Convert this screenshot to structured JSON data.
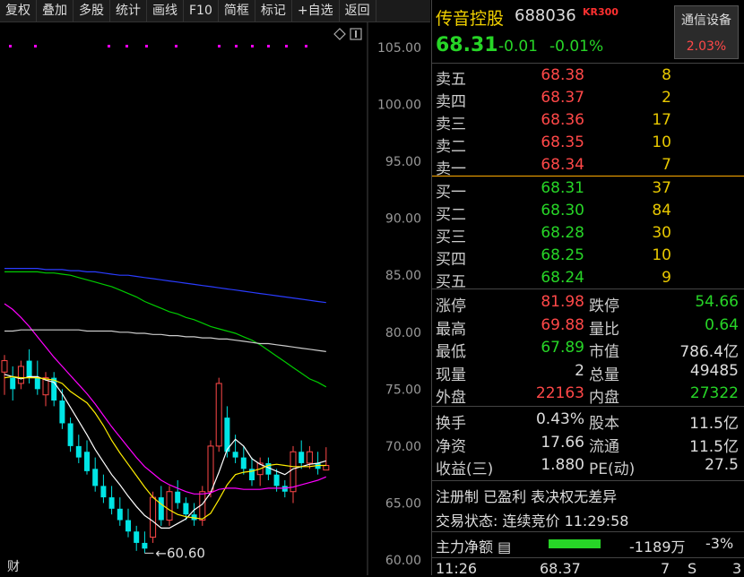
{
  "toolbar": {
    "items": [
      "复权",
      "叠加",
      "多股",
      "统计",
      "画线",
      "F10",
      "简框",
      "标记",
      "+自选",
      "返回"
    ]
  },
  "chart": {
    "y_axis_labels": [
      "105.00",
      "100.00",
      "95.00",
      "90.00",
      "85.00",
      "80.00",
      "75.00",
      "70.00",
      "65.00",
      "60.00"
    ],
    "low_marker": "60.60",
    "bottom_tab": "财",
    "colors": {
      "up": "#ff4848",
      "down": "#00e5e5",
      "ma5": "#ffffff",
      "ma10": "#ffee00",
      "ma20": "#ff00ff",
      "ma60": "#00cc00",
      "ma120": "#cccccc",
      "ma250": "#2a3cff"
    }
  },
  "chart_data": {
    "type": "candlestick",
    "ylim": [
      60,
      107
    ],
    "y_ticks": [
      60,
      65,
      70,
      75,
      80,
      85,
      90,
      95,
      100,
      105
    ],
    "candles": [
      {
        "o": 76.5,
        "h": 78.0,
        "l": 74.5,
        "c": 77.5
      },
      {
        "o": 76.0,
        "h": 77.0,
        "l": 74.0,
        "c": 75.0
      },
      {
        "o": 75.5,
        "h": 77.5,
        "l": 75.0,
        "c": 77.0
      },
      {
        "o": 77.5,
        "h": 78.5,
        "l": 75.5,
        "c": 76.0
      },
      {
        "o": 76.0,
        "h": 77.5,
        "l": 74.5,
        "c": 75.0
      },
      {
        "o": 74.5,
        "h": 76.5,
        "l": 73.5,
        "c": 76.0
      },
      {
        "o": 76.0,
        "h": 76.5,
        "l": 73.5,
        "c": 74.0
      },
      {
        "o": 74.0,
        "h": 75.0,
        "l": 71.5,
        "c": 72.0
      },
      {
        "o": 72.0,
        "h": 72.5,
        "l": 69.5,
        "c": 70.0
      },
      {
        "o": 70.0,
        "h": 71.0,
        "l": 68.5,
        "c": 69.0
      },
      {
        "o": 69.5,
        "h": 70.5,
        "l": 67.5,
        "c": 67.8
      },
      {
        "o": 68.0,
        "h": 69.0,
        "l": 66.0,
        "c": 66.5
      },
      {
        "o": 66.5,
        "h": 67.5,
        "l": 65.0,
        "c": 65.5
      },
      {
        "o": 65.5,
        "h": 66.5,
        "l": 64.0,
        "c": 64.5
      },
      {
        "o": 64.5,
        "h": 65.5,
        "l": 63.0,
        "c": 63.5
      },
      {
        "o": 63.5,
        "h": 64.5,
        "l": 62.0,
        "c": 62.5
      },
      {
        "o": 62.5,
        "h": 63.0,
        "l": 60.8,
        "c": 61.5
      },
      {
        "o": 61.5,
        "h": 62.5,
        "l": 60.6,
        "c": 61.0
      },
      {
        "o": 62.0,
        "h": 66.0,
        "l": 61.5,
        "c": 65.5
      },
      {
        "o": 65.5,
        "h": 66.5,
        "l": 63.0,
        "c": 63.5
      },
      {
        "o": 63.5,
        "h": 66.5,
        "l": 63.0,
        "c": 66.0
      },
      {
        "o": 66.0,
        "h": 67.0,
        "l": 64.5,
        "c": 65.0
      },
      {
        "o": 65.0,
        "h": 65.5,
        "l": 63.5,
        "c": 64.0
      },
      {
        "o": 64.0,
        "h": 65.0,
        "l": 63.0,
        "c": 63.5
      },
      {
        "o": 63.5,
        "h": 66.5,
        "l": 63.0,
        "c": 66.0
      },
      {
        "o": 66.0,
        "h": 70.5,
        "l": 65.5,
        "c": 70.0
      },
      {
        "o": 70.0,
        "h": 76.0,
        "l": 69.5,
        "c": 75.5
      },
      {
        "o": 72.5,
        "h": 73.5,
        "l": 69.0,
        "c": 69.5
      },
      {
        "o": 69.5,
        "h": 71.0,
        "l": 68.5,
        "c": 69.0
      },
      {
        "o": 69.0,
        "h": 70.0,
        "l": 67.5,
        "c": 68.0
      },
      {
        "o": 68.0,
        "h": 69.0,
        "l": 66.5,
        "c": 67.0
      },
      {
        "o": 67.5,
        "h": 69.0,
        "l": 66.5,
        "c": 68.5
      },
      {
        "o": 68.5,
        "h": 69.0,
        "l": 67.0,
        "c": 67.5
      },
      {
        "o": 67.5,
        "h": 68.0,
        "l": 66.0,
        "c": 66.5
      },
      {
        "o": 66.5,
        "h": 67.0,
        "l": 65.5,
        "c": 66.0
      },
      {
        "o": 66.0,
        "h": 70.0,
        "l": 65.0,
        "c": 69.5
      },
      {
        "o": 69.5,
        "h": 70.5,
        "l": 68.0,
        "c": 68.5
      },
      {
        "o": 68.5,
        "h": 70.0,
        "l": 68.0,
        "c": 69.5
      },
      {
        "o": 68.5,
        "h": 69.5,
        "l": 67.5,
        "c": 68.0
      },
      {
        "o": 67.9,
        "h": 69.9,
        "l": 67.9,
        "c": 68.3
      }
    ],
    "ma_lines": [
      {
        "name": "MA5",
        "color": "#ffffff",
        "values": [
          76.3,
          76.1,
          75.9,
          76.1,
          76.1,
          75.8,
          75.6,
          74.6,
          73.4,
          72.2,
          71.0,
          69.7,
          68.6,
          67.5,
          66.6,
          65.6,
          64.7,
          63.9,
          63.4,
          62.8,
          62.8,
          63.2,
          63.6,
          64.4,
          64.9,
          65.9,
          67.7,
          69.7,
          70.6,
          70.0,
          68.9,
          68.4,
          68.1,
          67.8,
          67.5,
          68.0,
          68.2,
          68.4,
          68.5,
          68.7
        ]
      },
      {
        "name": "MA10",
        "color": "#ffee00",
        "values": [
          76.0,
          76.1,
          76.0,
          76.0,
          76.0,
          75.9,
          75.8,
          75.5,
          74.8,
          74.3,
          73.8,
          72.9,
          71.8,
          70.5,
          69.4,
          68.4,
          67.4,
          66.4,
          65.5,
          64.9,
          64.4,
          64.0,
          63.8,
          63.7,
          63.6,
          64.1,
          65.3,
          66.6,
          67.5,
          67.7,
          67.8,
          68.0,
          68.3,
          68.4,
          68.3,
          68.2,
          68.2,
          68.2,
          68.3,
          68.3
        ]
      },
      {
        "name": "MA20",
        "color": "#ff00ff",
        "values": [
          82.5,
          82.0,
          81.3,
          80.5,
          79.6,
          78.7,
          77.8,
          77.0,
          76.2,
          75.4,
          74.6,
          73.7,
          72.7,
          71.7,
          70.8,
          69.9,
          69.0,
          68.2,
          67.6,
          67.0,
          66.6,
          66.3,
          66.0,
          65.8,
          65.8,
          65.9,
          66.2,
          66.3,
          66.3,
          66.2,
          66.2,
          66.2,
          66.3,
          66.3,
          66.3,
          66.4,
          66.6,
          66.8,
          67.0,
          67.3
        ]
      },
      {
        "name": "MA60",
        "color": "#00cc00",
        "values": [
          85.3,
          85.3,
          85.3,
          85.3,
          85.3,
          85.2,
          85.2,
          85.1,
          85.0,
          84.8,
          84.6,
          84.4,
          84.2,
          84.0,
          83.7,
          83.4,
          83.1,
          82.7,
          82.4,
          82.1,
          81.8,
          81.6,
          81.3,
          81.1,
          80.8,
          80.5,
          80.3,
          80.1,
          79.9,
          79.6,
          79.3,
          78.9,
          78.4,
          77.9,
          77.4,
          76.9,
          76.4,
          75.9,
          75.6,
          75.2
        ]
      },
      {
        "name": "MA120",
        "color": "#cccccc",
        "values": [
          80.1,
          80.1,
          80.2,
          80.2,
          80.2,
          80.2,
          80.2,
          80.2,
          80.2,
          80.2,
          80.1,
          80.1,
          80.1,
          80.1,
          80.0,
          80.0,
          79.9,
          79.9,
          79.8,
          79.8,
          79.7,
          79.7,
          79.6,
          79.6,
          79.5,
          79.5,
          79.4,
          79.4,
          79.3,
          79.2,
          79.1,
          79.0,
          79.0,
          78.9,
          78.8,
          78.7,
          78.6,
          78.5,
          78.4,
          78.3
        ]
      },
      {
        "name": "MA250",
        "color": "#2a3cff",
        "values": [
          85.6,
          85.6,
          85.6,
          85.6,
          85.6,
          85.5,
          85.5,
          85.5,
          85.4,
          85.4,
          85.3,
          85.3,
          85.2,
          85.1,
          85.0,
          85.0,
          84.9,
          84.8,
          84.7,
          84.6,
          84.5,
          84.4,
          84.3,
          84.2,
          84.1,
          84.0,
          83.9,
          83.8,
          83.7,
          83.6,
          83.5,
          83.4,
          83.3,
          83.2,
          83.1,
          83.0,
          82.9,
          82.8,
          82.7,
          82.6
        ]
      }
    ]
  },
  "quote": {
    "name": "传音控股",
    "code": "688036",
    "badge": "KR300",
    "last": "68.31",
    "change": "-0.01",
    "change_pct": "-0.01%",
    "sector_name": "通信设备",
    "sector_pct": "2.03%",
    "asks": [
      {
        "label": "卖五",
        "price": "68.38",
        "vol": "8"
      },
      {
        "label": "卖四",
        "price": "68.37",
        "vol": "2"
      },
      {
        "label": "卖三",
        "price": "68.36",
        "vol": "17"
      },
      {
        "label": "卖二",
        "price": "68.35",
        "vol": "10"
      },
      {
        "label": "卖一",
        "price": "68.34",
        "vol": "7"
      }
    ],
    "bids": [
      {
        "label": "买一",
        "price": "68.31",
        "vol": "37"
      },
      {
        "label": "买二",
        "price": "68.30",
        "vol": "84"
      },
      {
        "label": "买三",
        "price": "68.28",
        "vol": "30"
      },
      {
        "label": "买四",
        "price": "68.25",
        "vol": "10"
      },
      {
        "label": "买五",
        "price": "68.24",
        "vol": "9"
      }
    ],
    "stats": [
      {
        "l1": "涨停",
        "v1": "81.98",
        "c1": "red",
        "l2": "跌停",
        "v2": "54.66",
        "c2": "green"
      },
      {
        "l1": "最高",
        "v1": "69.88",
        "c1": "red",
        "l2": "量比",
        "v2": "0.64",
        "c2": "green"
      },
      {
        "l1": "最低",
        "v1": "67.89",
        "c1": "green",
        "l2": "市值",
        "v2": "786.4亿",
        "c2": "white"
      },
      {
        "l1": "现量",
        "v1": "2",
        "c1": "white",
        "l2": "总量",
        "v2": "49485",
        "c2": "white"
      },
      {
        "l1": "外盘",
        "v1": "22163",
        "c1": "red",
        "l2": "内盘",
        "v2": "27322",
        "c2": "green"
      }
    ],
    "stats2": [
      {
        "l1": "换手",
        "v1": "0.43%",
        "l2": "股本",
        "v2": "11.5亿"
      },
      {
        "l1": "净资",
        "v1": "17.66",
        "l2": "流通",
        "v2": "11.5亿"
      },
      {
        "l1": "收益(三)",
        "v1": "1.880",
        "l2": "PE(动)",
        "v2": "27.5"
      }
    ],
    "tags": "注册制 已盈利 表决权无差异",
    "trade_status": "交易状态: 连续竞价 11:29:58",
    "main_flow_label": "主力净额",
    "main_flow_value": "-1189万",
    "main_flow_pct": "-3%",
    "main_flow_bar_fraction": 0.5,
    "tick": {
      "time": "11:26",
      "price": "68.37",
      "vol": "7",
      "side": "S",
      "count": "3"
    }
  }
}
